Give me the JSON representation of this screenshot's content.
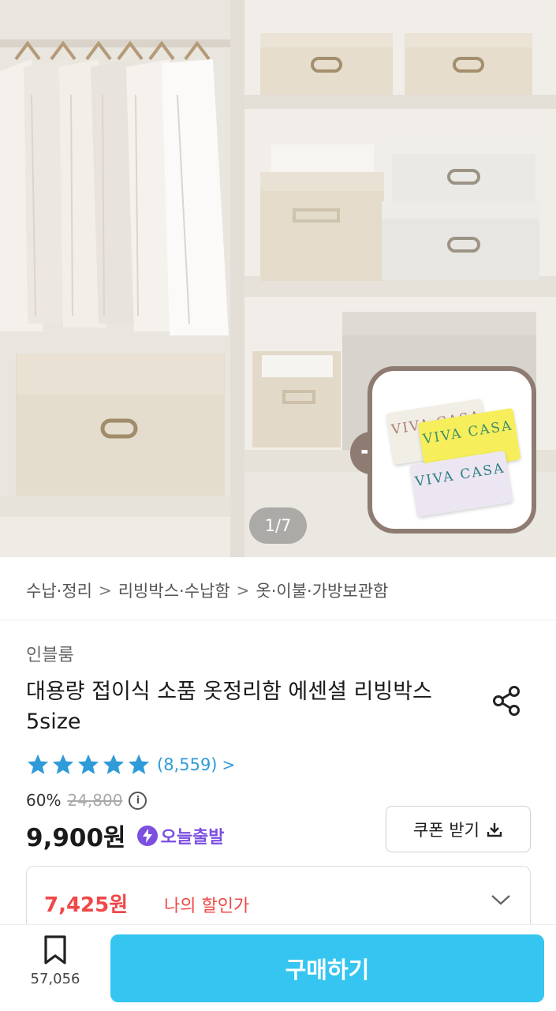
{
  "hero": {
    "page_indicator": "1/7",
    "gift_plus": "+",
    "soap_texts": [
      "VIVA CASA",
      "VIVA CASA",
      "VIVA CASA"
    ]
  },
  "breadcrumb": {
    "items": [
      "수납·정리",
      "리빙박스·수납함",
      "옷·이불·가방보관함"
    ],
    "separator": ">"
  },
  "product": {
    "brand": "인블룸",
    "title": "대용량 접이식 소품 옷정리함 에센셜 리빙박스 5size",
    "rating": {
      "stars": 5,
      "count_text": "(8,559)",
      "chevron": ">",
      "star_color": "#2f9bd8"
    },
    "discount_percent": "60%",
    "original_price": "24,800",
    "info_symbol": "i",
    "price": "9,900원",
    "delivery_badge": "오늘출발",
    "coupon_button": "쿠폰 받기"
  },
  "my_discount": {
    "price": "7,425원",
    "label": "나의 할인가"
  },
  "bottom_bar": {
    "bookmark_count": "57,056",
    "buy_button": "구매하기",
    "buy_color": "#35c5f0"
  },
  "colors": {
    "accent": "#35c5f0",
    "sale_red": "#f04848",
    "delivery_purple": "#7b4fe0"
  }
}
